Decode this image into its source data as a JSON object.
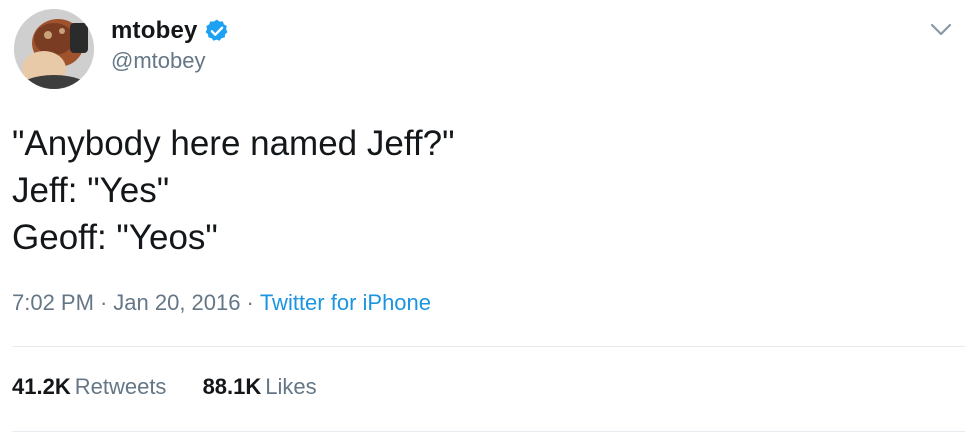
{
  "tweet": {
    "display_name": "mtobey",
    "handle": "@mtobey",
    "verified": true,
    "verified_color": "#1da1f2",
    "text_lines": [
      "\"Anybody here named Jeff?\"",
      "Jeff: \"Yes\"",
      "Geoff: \"Yeos\""
    ],
    "time": "7:02 PM",
    "date": "Jan 20, 2016",
    "separator": "·",
    "source": "Twitter for iPhone",
    "source_color": "#1b95e0",
    "stats": {
      "retweets_count": "41.2K",
      "retweets_label": "Retweets",
      "likes_count": "88.1K",
      "likes_label": "Likes"
    },
    "icons": {
      "verified": "verified-badge-icon",
      "caret": "chevron-down-icon"
    }
  }
}
